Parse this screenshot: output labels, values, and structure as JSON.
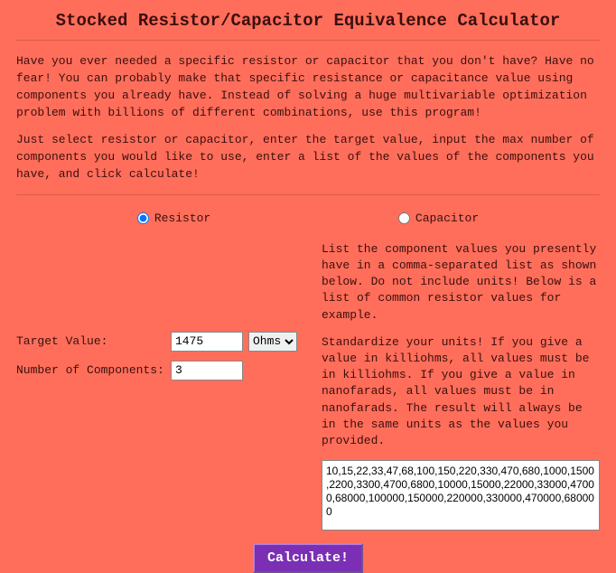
{
  "title": "Stocked Resistor/Capacitor Equivalence Calculator",
  "intro1": "Have you ever needed a specific resistor or capacitor that you don't have? Have no fear! You can probably make that specific resistance or capacitance value using components you already have. Instead of solving a huge multivariable optimization problem with billions of different combinations, use this program!",
  "intro2": "Just select resistor or capacitor, enter the target value, input the max number of components you would like to use, enter a list of the values of the components you have, and click calculate!",
  "radios": {
    "resistor": "Resistor",
    "capacitor": "Capacitor"
  },
  "left": {
    "target_label": "Target Value:",
    "target_value": "1475",
    "unit_value": "Ohms",
    "numcomp_label": "Number of Components:",
    "numcomp_value": "3"
  },
  "right": {
    "p1": "List the component values you presently have in a comma-separated list as shown below. Do not include units! Below is a list of common resistor values for example.",
    "p2": "Standardize your units! If you give a value in killiohms, all values must be in killiohms. If you give a value in nanofarads, all values must be in nanofarads. The result will always be in the same units as the values you provided.",
    "values": "10,15,22,33,47,68,100,150,220,330,470,680,1000,1500,2200,3300,4700,6800,10000,15000,22000,33000,47000,68000,100000,150000,220000,330000,470000,680000"
  },
  "calculate_label": "Calculate!"
}
